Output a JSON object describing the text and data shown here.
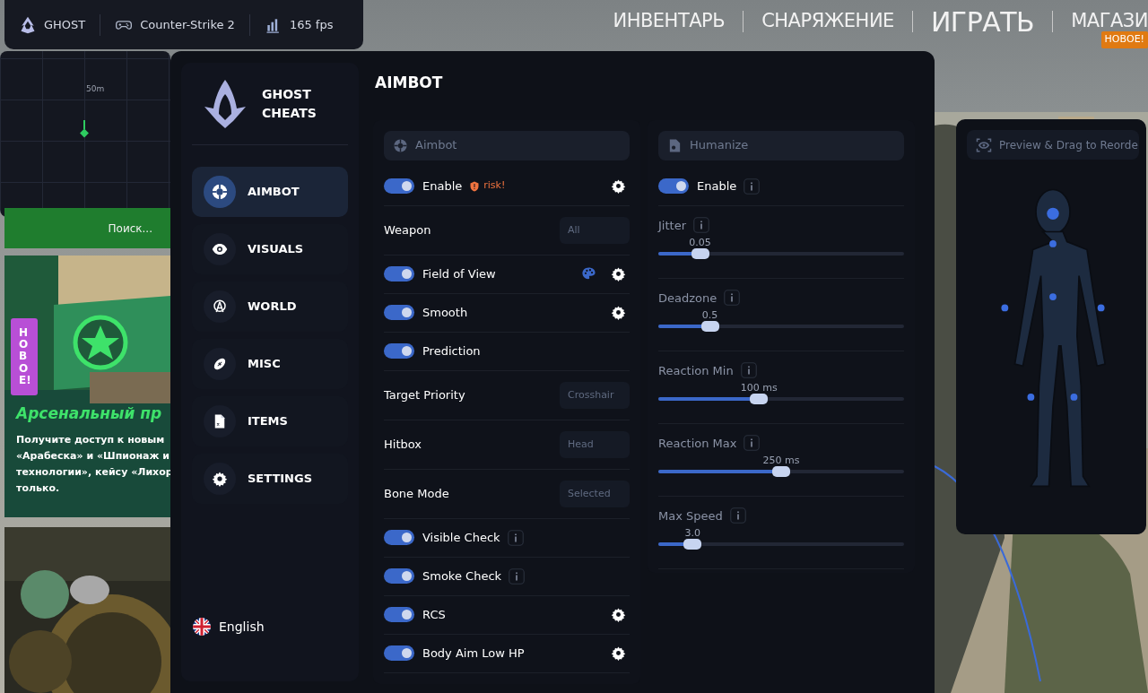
{
  "topbar": {
    "items": [
      {
        "kind": "logo",
        "label": "GHOST"
      },
      {
        "kind": "gamepad",
        "label": "Counter-Strike 2"
      },
      {
        "kind": "bars",
        "label": "165 fps"
      }
    ]
  },
  "radar": {
    "label": "50m"
  },
  "game_nav": {
    "items": [
      {
        "label": "ИНВЕНТАРЬ",
        "selected": false
      },
      {
        "label": "СНАРЯЖЕНИЕ",
        "selected": false
      },
      {
        "label": "ИГРАТЬ",
        "selected": true
      },
      {
        "label": "МАГАЗИ",
        "selected": false,
        "badge": "НОВОЕ!"
      }
    ]
  },
  "search_tile": {
    "label": "Поиск..."
  },
  "news": {
    "badge": "НОВОЕ!",
    "title": "Арсенальный пр",
    "lines": [
      "Получите доступ к новым",
      "«Арабеска» и «Шпионаж и",
      "технологии», кейсу «Лихор",
      "только."
    ]
  },
  "menu": {
    "brand": "GHOST CHEATS",
    "nav": [
      {
        "kind": "crosshair",
        "label": "AIMBOT",
        "selected": true
      },
      {
        "kind": "eye",
        "label": "VISUALS",
        "selected": false
      },
      {
        "kind": "world",
        "label": "WORLD",
        "selected": false
      },
      {
        "kind": "ball",
        "label": "MISC",
        "selected": false
      },
      {
        "kind": "file",
        "label": "ITEMS",
        "selected": false
      },
      {
        "kind": "gear",
        "label": "SETTINGS",
        "selected": false
      }
    ],
    "language": "English",
    "page_title": "AIMBOT",
    "aimbot": {
      "title": "Aimbot",
      "rows": [
        {
          "kind": "toggle",
          "label": "Enable",
          "on": true,
          "risk": "risk!",
          "gear": true
        },
        {
          "kind": "select",
          "label": "Weapon",
          "value": "All"
        },
        {
          "kind": "toggle",
          "label": "Field of View",
          "on": true,
          "palette": true,
          "gear": true
        },
        {
          "kind": "toggle",
          "label": "Smooth",
          "on": true,
          "gear": true
        },
        {
          "kind": "toggle",
          "label": "Prediction",
          "on": true
        },
        {
          "kind": "select",
          "label": "Target Priority",
          "value": "Crosshair"
        },
        {
          "kind": "select",
          "label": "Hitbox",
          "value": "Head"
        },
        {
          "kind": "select",
          "label": "Bone Mode",
          "value": "Selected"
        },
        {
          "kind": "toggle",
          "label": "Visible Check",
          "on": true,
          "info": true
        },
        {
          "kind": "toggle",
          "label": "Smoke Check",
          "on": true,
          "info": true
        },
        {
          "kind": "toggle",
          "label": "RCS",
          "on": true,
          "gear": true
        },
        {
          "kind": "toggle",
          "label": "Body Aim Low HP",
          "on": true,
          "gear": true
        }
      ]
    },
    "humanize": {
      "title": "Humanize",
      "rows": [
        {
          "kind": "toggle",
          "label": "Enable",
          "on": true,
          "info": true
        },
        {
          "kind": "slider",
          "label": "Jitter",
          "info": true,
          "reading": "0.05",
          "level": 0.17
        },
        {
          "kind": "slider",
          "label": "Deadzone",
          "info": true,
          "reading": "0.5",
          "level": 0.21
        },
        {
          "kind": "slider",
          "label": "Reaction Min",
          "info": true,
          "reading": "100 ms",
          "level": 0.41
        },
        {
          "kind": "slider",
          "label": "Reaction Max",
          "info": true,
          "reading": "250 ms",
          "level": 0.5
        },
        {
          "kind": "slider",
          "label": "Max Speed",
          "info": true,
          "reading": "3.0",
          "level": 0.14
        }
      ]
    }
  },
  "preview": {
    "title": "Preview & Drag to Reorde"
  }
}
